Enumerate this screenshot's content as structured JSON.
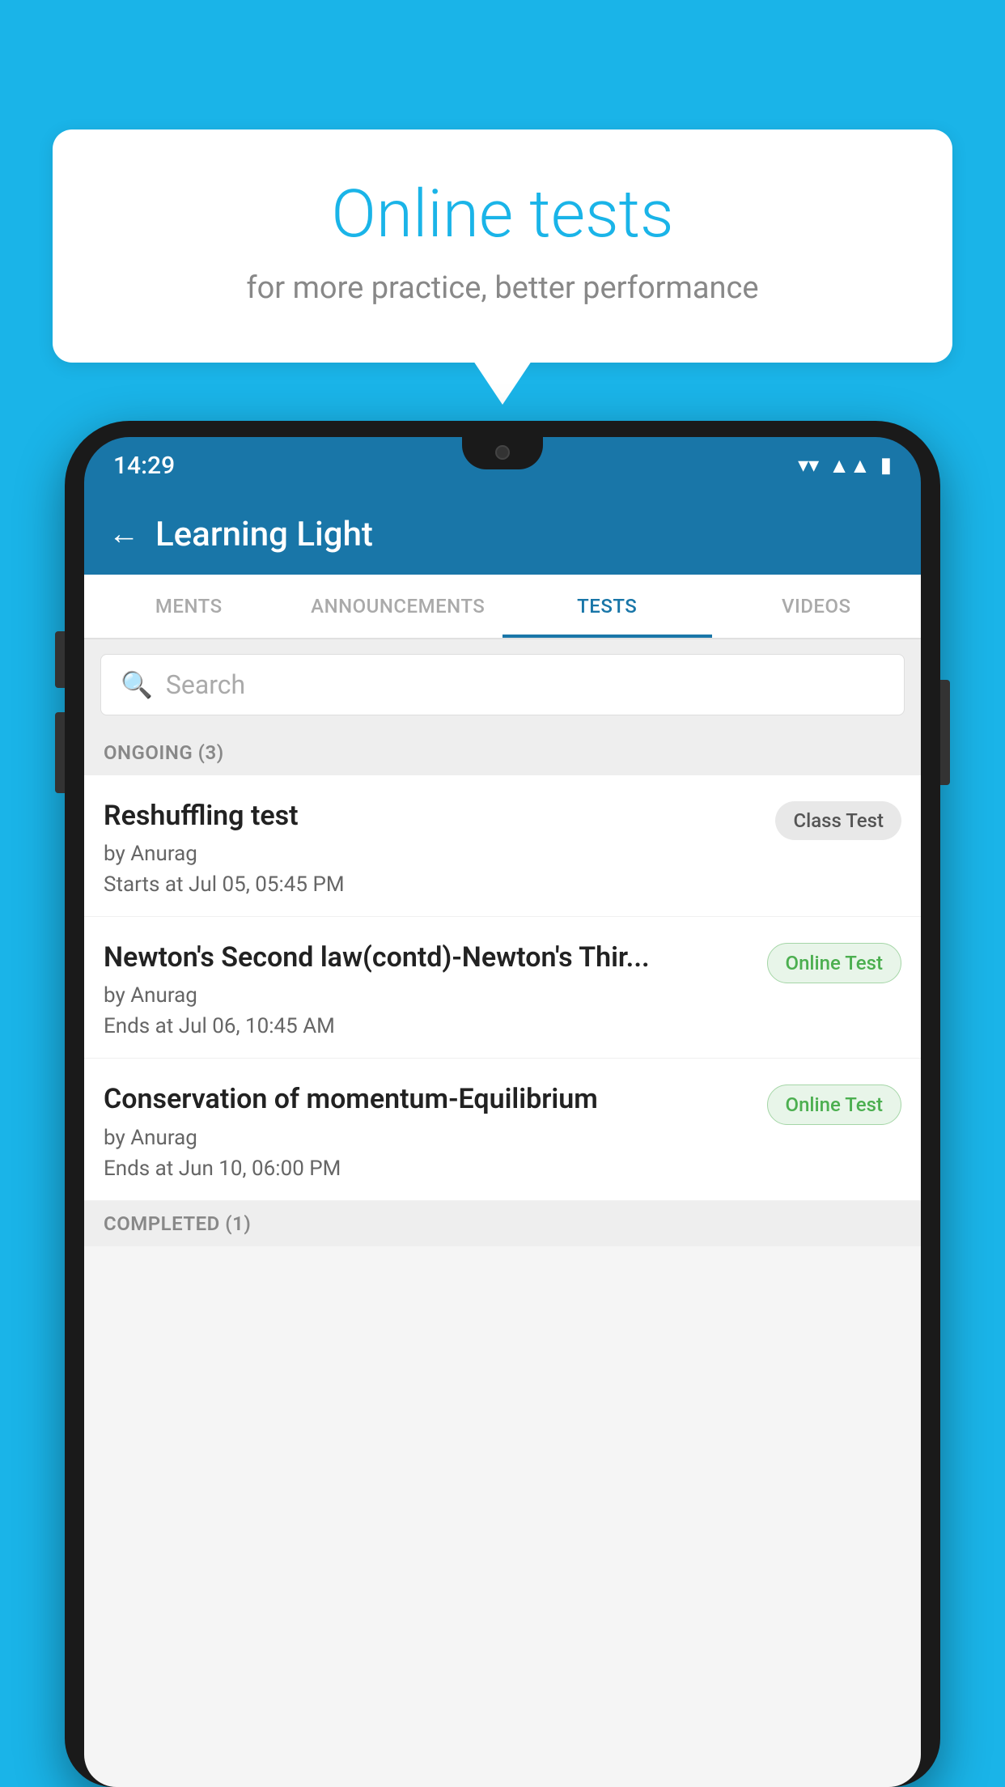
{
  "background_color": "#1ab4e8",
  "speech_bubble": {
    "title": "Online tests",
    "subtitle": "for more practice, better performance"
  },
  "phone": {
    "status_bar": {
      "time": "14:29",
      "wifi": "▼",
      "signal": "▲",
      "battery": "▮"
    },
    "app_header": {
      "back_label": "←",
      "title": "Learning Light"
    },
    "tabs": [
      {
        "label": "MENTS",
        "active": false
      },
      {
        "label": "ANNOUNCEMENTS",
        "active": false
      },
      {
        "label": "TESTS",
        "active": true
      },
      {
        "label": "VIDEOS",
        "active": false
      }
    ],
    "search": {
      "placeholder": "Search",
      "icon": "🔍"
    },
    "ongoing_section": {
      "label": "ONGOING (3)",
      "items": [
        {
          "name": "Reshuffling test",
          "author": "by Anurag",
          "time_label": "Starts at",
          "time": "Jul 05, 05:45 PM",
          "badge": "Class Test",
          "badge_type": "class"
        },
        {
          "name": "Newton's Second law(contd)-Newton's Thir...",
          "author": "by Anurag",
          "time_label": "Ends at",
          "time": "Jul 06, 10:45 AM",
          "badge": "Online Test",
          "badge_type": "online"
        },
        {
          "name": "Conservation of momentum-Equilibrium",
          "author": "by Anurag",
          "time_label": "Ends at",
          "time": "Jun 10, 06:00 PM",
          "badge": "Online Test",
          "badge_type": "online"
        }
      ]
    },
    "completed_section": {
      "label": "COMPLETED (1)"
    }
  }
}
